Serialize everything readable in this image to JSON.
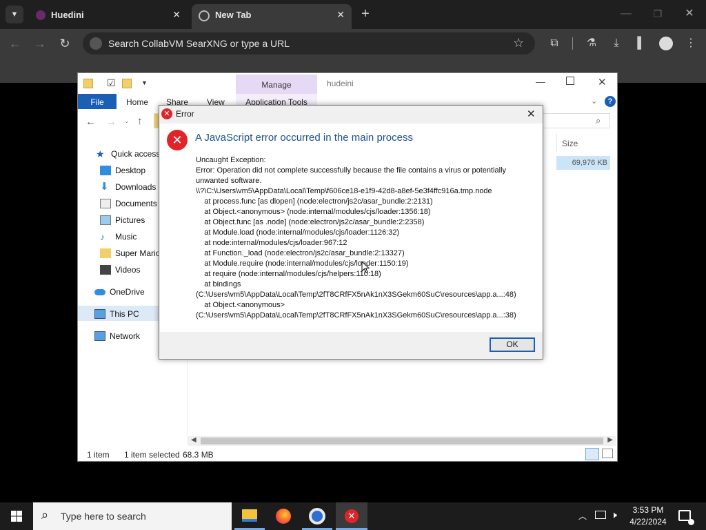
{
  "browser": {
    "tabs": [
      {
        "title": "Huedini"
      },
      {
        "title": "New Tab"
      }
    ],
    "omnibox_placeholder": "Search CollabVM SearXNG or type a URL"
  },
  "explorer": {
    "title": "hudeini",
    "quick_access_icons": [
      "folder-icon",
      "properties-icon",
      "new-folder-icon"
    ],
    "ribbon": {
      "manage": "Manage",
      "tabs": [
        "File",
        "Home",
        "Share",
        "View",
        "Application Tools"
      ]
    },
    "columns": {
      "size": "Size"
    },
    "file_size": "69,976 KB",
    "nav": [
      {
        "label": "Quick access",
        "icon": "star-icon"
      },
      {
        "label": "Desktop",
        "icon": "desktop-icon"
      },
      {
        "label": "Downloads",
        "icon": "downloads-icon"
      },
      {
        "label": "Documents",
        "icon": "documents-icon"
      },
      {
        "label": "Pictures",
        "icon": "pictures-icon"
      },
      {
        "label": "Music",
        "icon": "music-icon"
      },
      {
        "label": "Super Mario",
        "icon": "folder-icon"
      },
      {
        "label": "Videos",
        "icon": "videos-icon"
      },
      {
        "label": "OneDrive",
        "icon": "cloud-icon"
      },
      {
        "label": "This PC",
        "icon": "pc-icon"
      },
      {
        "label": "Network",
        "icon": "network-icon"
      }
    ],
    "status": {
      "items": "1 item",
      "selected": "1 item selected",
      "size": "68.3 MB"
    }
  },
  "dialog": {
    "title": "Error",
    "heading": "A JavaScript error occurred in the main process",
    "lines": [
      "Uncaught Exception:",
      "Error: Operation did not complete successfully because the file contains a virus or potentially",
      "unwanted software.",
      "\\\\?\\C:\\Users\\vm5\\AppData\\Local\\Temp\\f606ce18-e1f9-42d8-a8ef-5e3f4ffc916a.tmp.node",
      "    at process.func [as dlopen] (node:electron/js2c/asar_bundle:2:2131)",
      "    at Object.<anonymous> (node:internal/modules/cjs/loader:1356:18)",
      "    at Object.func [as .node] (node:electron/js2c/asar_bundle:2:2358)",
      "    at Module.load (node:internal/modules/cjs/loader:1126:32)",
      "    at node:internal/modules/cjs/loader:967:12",
      "    at Function._load (node:electron/js2c/asar_bundle:2:13327)",
      "    at Module.require (node:internal/modules/cjs/loader:1150:19)",
      "    at require (node:internal/modules/cjs/helpers:110:18)",
      "    at bindings",
      "(C:\\Users\\vm5\\AppData\\Local\\Temp\\2fT8CRfFX5nAk1nX3SGekm60SuC\\resources\\app.a...:48)",
      "    at Object.<anonymous>",
      "(C:\\Users\\vm5\\AppData\\Local\\Temp\\2fT8CRfFX5nAk1nX3SGekm60SuC\\resources\\app.a...:38)"
    ],
    "ok_label": "OK"
  },
  "taskbar": {
    "search_placeholder": "Type here to search",
    "apps": [
      "file-explorer-icon",
      "firefox-icon",
      "chrome-icon",
      "error-app-icon"
    ],
    "time": "3:53 PM",
    "date": "4/22/2024"
  },
  "colors": {
    "accent": "#1a5fb4",
    "dialog_heading": "#1e4e8c",
    "manage_bg": "#e6d9f5",
    "error_red": "#e0252a"
  }
}
